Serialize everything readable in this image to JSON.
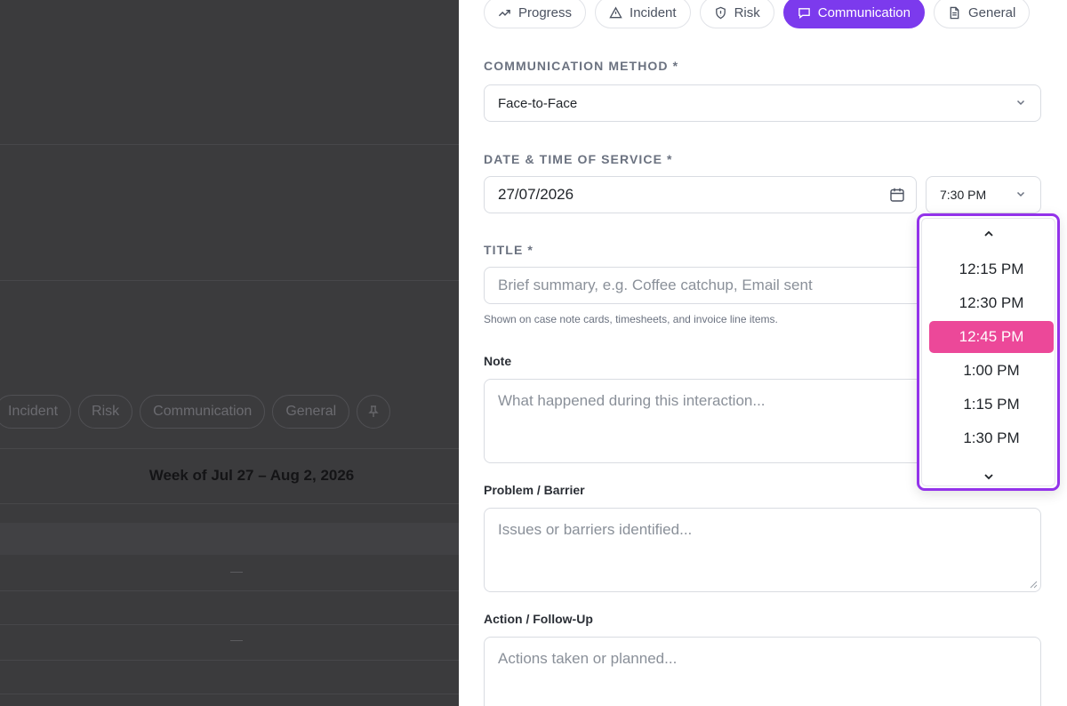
{
  "background": {
    "chips": [
      "Incident",
      "Risk",
      "Communication",
      "General"
    ],
    "week_label": "Week of Jul 27 – Aug 2, 2026",
    "dash_1": "—",
    "dash_2": "—"
  },
  "tabs": [
    {
      "label": "Progress",
      "icon": "trend-up-icon",
      "active": false
    },
    {
      "label": "Incident",
      "icon": "warning-icon",
      "active": false
    },
    {
      "label": "Risk",
      "icon": "shield-icon",
      "active": false
    },
    {
      "label": "Communication",
      "icon": "message-icon",
      "active": true
    },
    {
      "label": "General",
      "icon": "document-icon",
      "active": false
    }
  ],
  "form": {
    "method_label": "COMMUNICATION METHOD *",
    "method_value": "Face-to-Face",
    "datetime_label": "DATE & TIME OF SERVICE *",
    "date_value": "27/07/2026",
    "time_value": "7:30 PM",
    "title_label": "TITLE *",
    "title_placeholder": "Brief summary, e.g. Coffee catchup, Email sent",
    "title_hint": "Shown on case note cards, timesheets, and invoice line items.",
    "note_label": "Note",
    "note_placeholder": "What happened during this interaction...",
    "problem_label": "Problem / Barrier",
    "problem_placeholder": "Issues or barriers identified...",
    "action_label": "Action / Follow-Up",
    "action_placeholder": "Actions taken or planned..."
  },
  "time_dropdown": {
    "options": [
      "12:15 PM",
      "12:30 PM",
      "12:45 PM",
      "1:00 PM",
      "1:15 PM",
      "1:30 PM"
    ],
    "selected": "12:45 PM"
  },
  "colors": {
    "accent_purple": "#7c3aed",
    "highlight_pink": "#ec4899",
    "dropdown_border": "#9333ea"
  }
}
